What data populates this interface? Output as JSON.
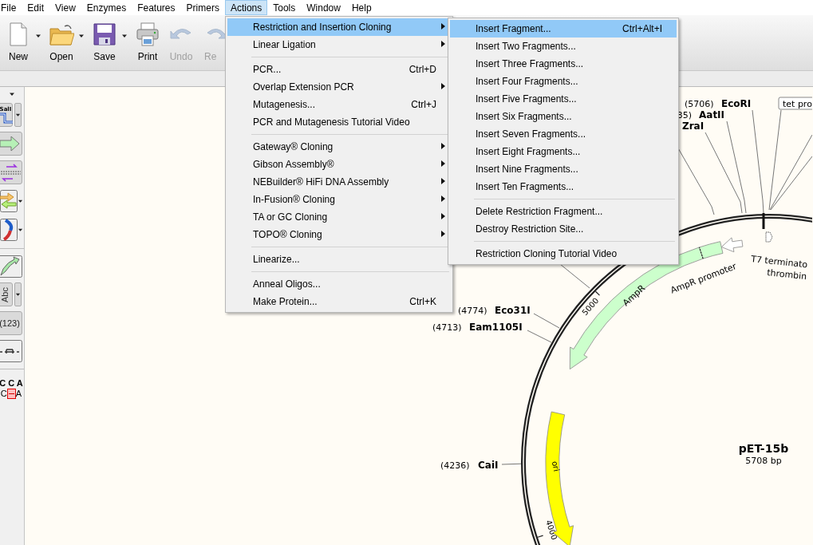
{
  "menu_bar": [
    {
      "label": "File",
      "selected": false
    },
    {
      "label": "Edit",
      "selected": false
    },
    {
      "label": "View",
      "selected": false
    },
    {
      "label": "Enzymes",
      "selected": false
    },
    {
      "label": "Features",
      "selected": false
    },
    {
      "label": "Primers",
      "selected": false
    },
    {
      "label": "Actions",
      "selected": true
    },
    {
      "label": "Tools",
      "selected": false
    },
    {
      "label": "Window",
      "selected": false
    },
    {
      "label": "Help",
      "selected": false
    }
  ],
  "toolbar": [
    {
      "kind": "new",
      "label": "New",
      "dropdown": true,
      "disabled": false
    },
    {
      "kind": "open",
      "label": "Open",
      "dropdown": true,
      "disabled": false
    },
    {
      "kind": "save",
      "label": "Save",
      "dropdown": true,
      "disabled": false
    },
    {
      "kind": "print",
      "label": "Print",
      "dropdown": false,
      "disabled": false
    },
    {
      "kind": "undo",
      "label": "Undo",
      "dropdown": false,
      "disabled": true
    },
    {
      "kind": "redo",
      "label": "Re",
      "dropdown": false,
      "disabled": true
    }
  ],
  "tool_palette": [
    {
      "kind": "collapse"
    },
    {
      "kind": "enzyme",
      "text": "SalI",
      "dropdown": true
    },
    {
      "kind": "feature",
      "dropdown": false
    },
    {
      "kind": "primers",
      "dropdown": false
    },
    {
      "kind": "orfs",
      "dropdown": true
    },
    {
      "kind": "arc",
      "dropdown": true
    },
    {
      "kind": "separator"
    },
    {
      "kind": "draw",
      "dropdown": false
    },
    {
      "kind": "text",
      "text": "Abc",
      "dropdown": true
    },
    {
      "kind": "numbers",
      "text": "(123)",
      "dropdown": false
    },
    {
      "kind": "line",
      "dropdown": false
    },
    {
      "kind": "separator"
    },
    {
      "kind": "alignment",
      "top": "C C A",
      "left": "C",
      "right": "A"
    }
  ],
  "actions_menu": [
    {
      "kind": "item",
      "label": "Restriction and Insertion Cloning",
      "submenu": true,
      "selected": true
    },
    {
      "kind": "item",
      "label": "Linear Ligation",
      "submenu": true,
      "selected": false
    },
    {
      "kind": "separator"
    },
    {
      "kind": "item",
      "label": "PCR...",
      "shortcut": "Ctrl+D",
      "selected": false
    },
    {
      "kind": "item",
      "label": "Overlap Extension PCR",
      "submenu": true,
      "selected": false
    },
    {
      "kind": "item",
      "label": "Mutagenesis...",
      "shortcut": "Ctrl+J",
      "selected": false
    },
    {
      "kind": "item",
      "label": "PCR and Mutagenesis Tutorial Video",
      "selected": false
    },
    {
      "kind": "separator"
    },
    {
      "kind": "item",
      "label": "Gateway® Cloning",
      "submenu": true,
      "selected": false
    },
    {
      "kind": "item",
      "label": "Gibson Assembly®",
      "submenu": true,
      "selected": false
    },
    {
      "kind": "item",
      "label": "NEBuilder® HiFi DNA Assembly",
      "submenu": true,
      "selected": false
    },
    {
      "kind": "item",
      "label": "In-Fusion® Cloning",
      "submenu": true,
      "selected": false
    },
    {
      "kind": "item",
      "label": "TA or GC Cloning",
      "submenu": true,
      "selected": false
    },
    {
      "kind": "item",
      "label": "TOPO® Cloning",
      "submenu": true,
      "selected": false
    },
    {
      "kind": "separator"
    },
    {
      "kind": "item",
      "label": "Linearize...",
      "selected": false
    },
    {
      "kind": "separator"
    },
    {
      "kind": "item",
      "label": "Anneal Oligos...",
      "selected": false
    },
    {
      "kind": "item",
      "label": "Make Protein...",
      "shortcut": "Ctrl+K",
      "selected": false
    }
  ],
  "cloning_submenu": [
    {
      "kind": "item",
      "label": "Insert Fragment...",
      "shortcut": "Ctrl+Alt+I",
      "selected": true
    },
    {
      "kind": "item",
      "label": "Insert Two Fragments...",
      "selected": false
    },
    {
      "kind": "item",
      "label": "Insert Three Fragments...",
      "selected": false
    },
    {
      "kind": "item",
      "label": "Insert Four Fragments...",
      "selected": false
    },
    {
      "kind": "item",
      "label": "Insert Five Fragments...",
      "selected": false
    },
    {
      "kind": "item",
      "label": "Insert Six Fragments...",
      "selected": false
    },
    {
      "kind": "item",
      "label": "Insert Seven Fragments...",
      "selected": false
    },
    {
      "kind": "item",
      "label": "Insert Eight Fragments...",
      "selected": false
    },
    {
      "kind": "item",
      "label": "Insert Nine Fragments...",
      "selected": false
    },
    {
      "kind": "item",
      "label": "Insert Ten Fragments...",
      "selected": false
    },
    {
      "kind": "separator"
    },
    {
      "kind": "item",
      "label": "Delete Restriction Fragment...",
      "selected": false
    },
    {
      "kind": "item",
      "label": "Destroy Restriction Site...",
      "selected": false
    },
    {
      "kind": "separator"
    },
    {
      "kind": "item",
      "label": "Restriction Cloning Tutorial Video",
      "selected": false
    }
  ],
  "map": {
    "name": "pET-15b",
    "length": "5708 bp",
    "features": [
      {
        "kind": "arrow",
        "name": "AmpR",
        "color": "#ccffcc"
      },
      {
        "kind": "box",
        "name": "AmpR promoter",
        "color": "#ccffcc"
      },
      {
        "kind": "arrow",
        "color": "#ffffff"
      },
      {
        "kind": "arrow",
        "name": "ori",
        "color": "#ffff00"
      },
      {
        "kind": "terminator",
        "name": "T7 terminato"
      },
      {
        "kind": "site",
        "name": "thrombin"
      },
      {
        "kind": "callout",
        "name": "tet pro"
      }
    ],
    "enzymes": [
      {
        "position": "(5706)",
        "name": "EcoRI"
      },
      {
        "position": "35)",
        "name": "AatII"
      },
      {
        "name": "ZraI"
      },
      {
        "position": "(4774)",
        "name": "Eco31I"
      },
      {
        "position": "(4713)",
        "name": "Eam1105I"
      },
      {
        "position": "(4236)",
        "name": "CaiI"
      }
    ],
    "ticks": [
      "5000",
      "4000"
    ]
  }
}
